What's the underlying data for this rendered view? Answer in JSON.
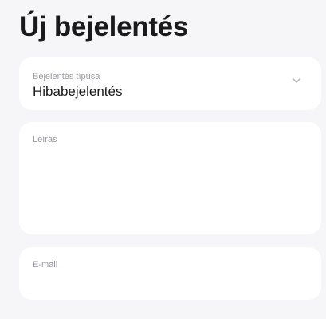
{
  "header": {
    "title": "Új bejelentés"
  },
  "form": {
    "report_type": {
      "label": "Bejelentés típusa",
      "value": "Hibabejelentés",
      "icon": "chevron-down-icon"
    },
    "description": {
      "label": "Leírás",
      "value": ""
    },
    "email": {
      "label": "E-mail",
      "value": ""
    }
  },
  "colors": {
    "background": "#f6f6f8",
    "card": "#ffffff",
    "label": "#9a9aa2",
    "text": "#1a1a1a"
  }
}
